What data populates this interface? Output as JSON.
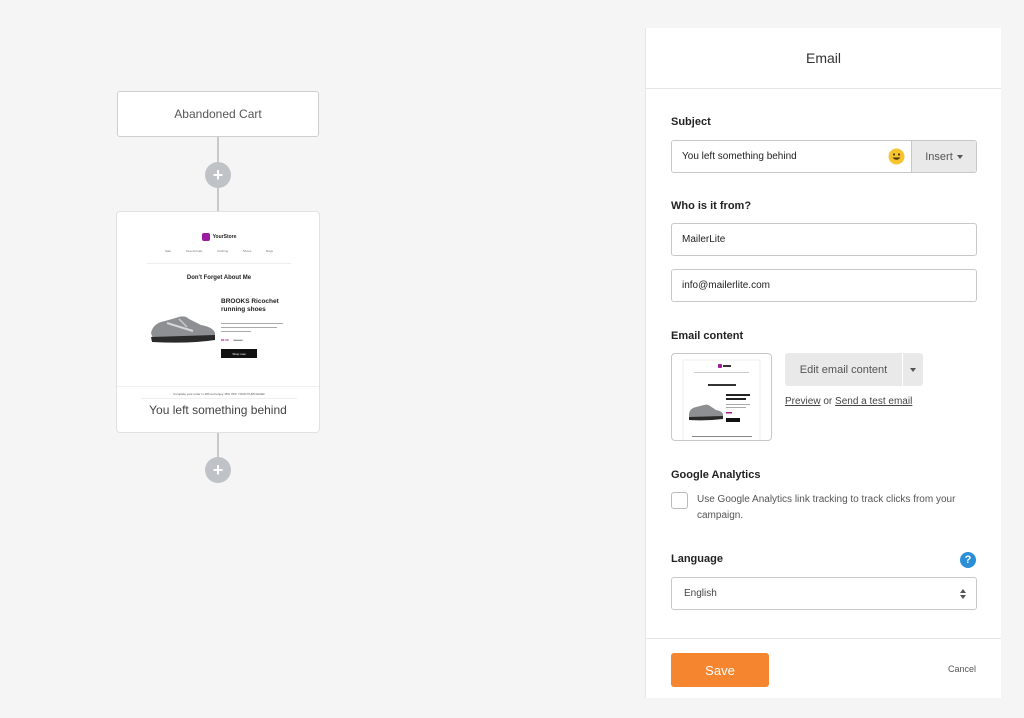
{
  "workflow": {
    "trigger_label": "Abandoned Cart",
    "add_step_symbol": "+",
    "email_node": {
      "caption": "You left something behind",
      "preview": {
        "store_name": "YourStore",
        "nav_items": [
          "Sale",
          "New Arrivals",
          "Clothing",
          "Shoes",
          "Bags"
        ],
        "headline": "Don't Forget About Me",
        "product_title": "BROOKS Ricochet running shoes",
        "price_now": "$0.00",
        "price_was": "$00.00",
        "shop_button": "Shop now",
        "footer_text": "Complete your order in 48h and enjoy 15% OFF YOUR PURCHASE!"
      }
    }
  },
  "panel": {
    "title": "Email",
    "subject": {
      "label": "Subject",
      "value": "You left something behind",
      "emoji_icon": "smiley-emoji-icon",
      "insert_label": "Insert"
    },
    "from": {
      "label": "Who is it from?",
      "name_value": "MailerLite",
      "email_value": "info@mailerlite.com"
    },
    "content": {
      "label": "Email content",
      "edit_label": "Edit email content",
      "preview_link": "Preview",
      "or_text": "or",
      "test_link": "Send a test email"
    },
    "analytics": {
      "label": "Google Analytics",
      "checkbox_text": "Use Google Analytics link tracking to track clicks from your campaign.",
      "checked": false
    },
    "language": {
      "label": "Language",
      "help_symbol": "?",
      "selected": "English"
    },
    "footer": {
      "save_label": "Save",
      "cancel_label": "Cancel"
    }
  },
  "colors": {
    "accent_orange": "#f5852e",
    "help_blue": "#2b8fd8",
    "brand_purple": "#9c1b9f"
  }
}
